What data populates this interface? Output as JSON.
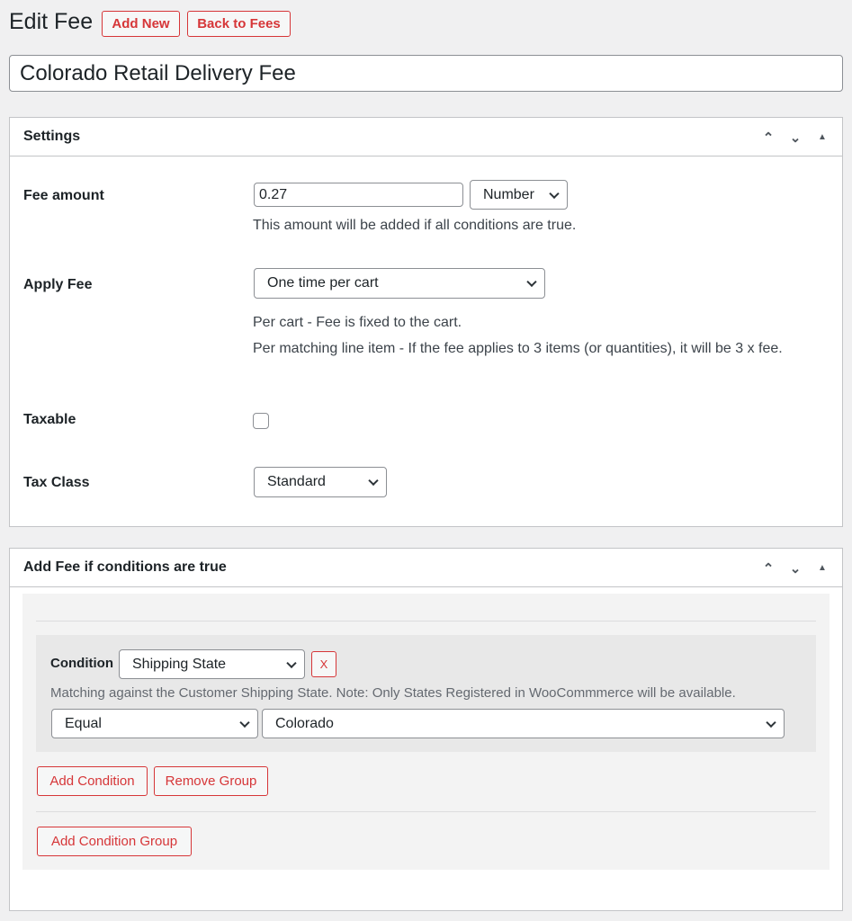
{
  "header": {
    "title": "Edit Fee",
    "add_new": "Add New",
    "back": "Back to Fees"
  },
  "fee_title": "Colorado Retail Delivery Fee",
  "settings": {
    "title": "Settings",
    "fee_amount": {
      "label": "Fee amount",
      "value": "0.27",
      "type": "Number",
      "desc": "This amount will be added if all conditions are true."
    },
    "apply_fee": {
      "label": "Apply Fee",
      "value": "One time per cart",
      "desc1": "Per cart - Fee is fixed to the cart.",
      "desc2": "Per matching line item - If the fee applies to 3 items (or quantities), it will be 3 x fee."
    },
    "taxable": {
      "label": "Taxable",
      "checked": false
    },
    "tax_class": {
      "label": "Tax Class",
      "value": "Standard"
    }
  },
  "conditions": {
    "title": "Add Fee if conditions are true",
    "condition_label": "Condition",
    "condition_value": "Shipping State",
    "remove_x": "X",
    "desc": "Matching against the Customer Shipping State. Note: Only States Registered in WooCommmerce will be available.",
    "operator": "Equal",
    "state": "Colorado",
    "add_condition": "Add Condition",
    "remove_group": "Remove Group",
    "add_group": "Add Condition Group"
  },
  "colors": {
    "accent": "#d63638",
    "background": "#f0f0f1"
  }
}
